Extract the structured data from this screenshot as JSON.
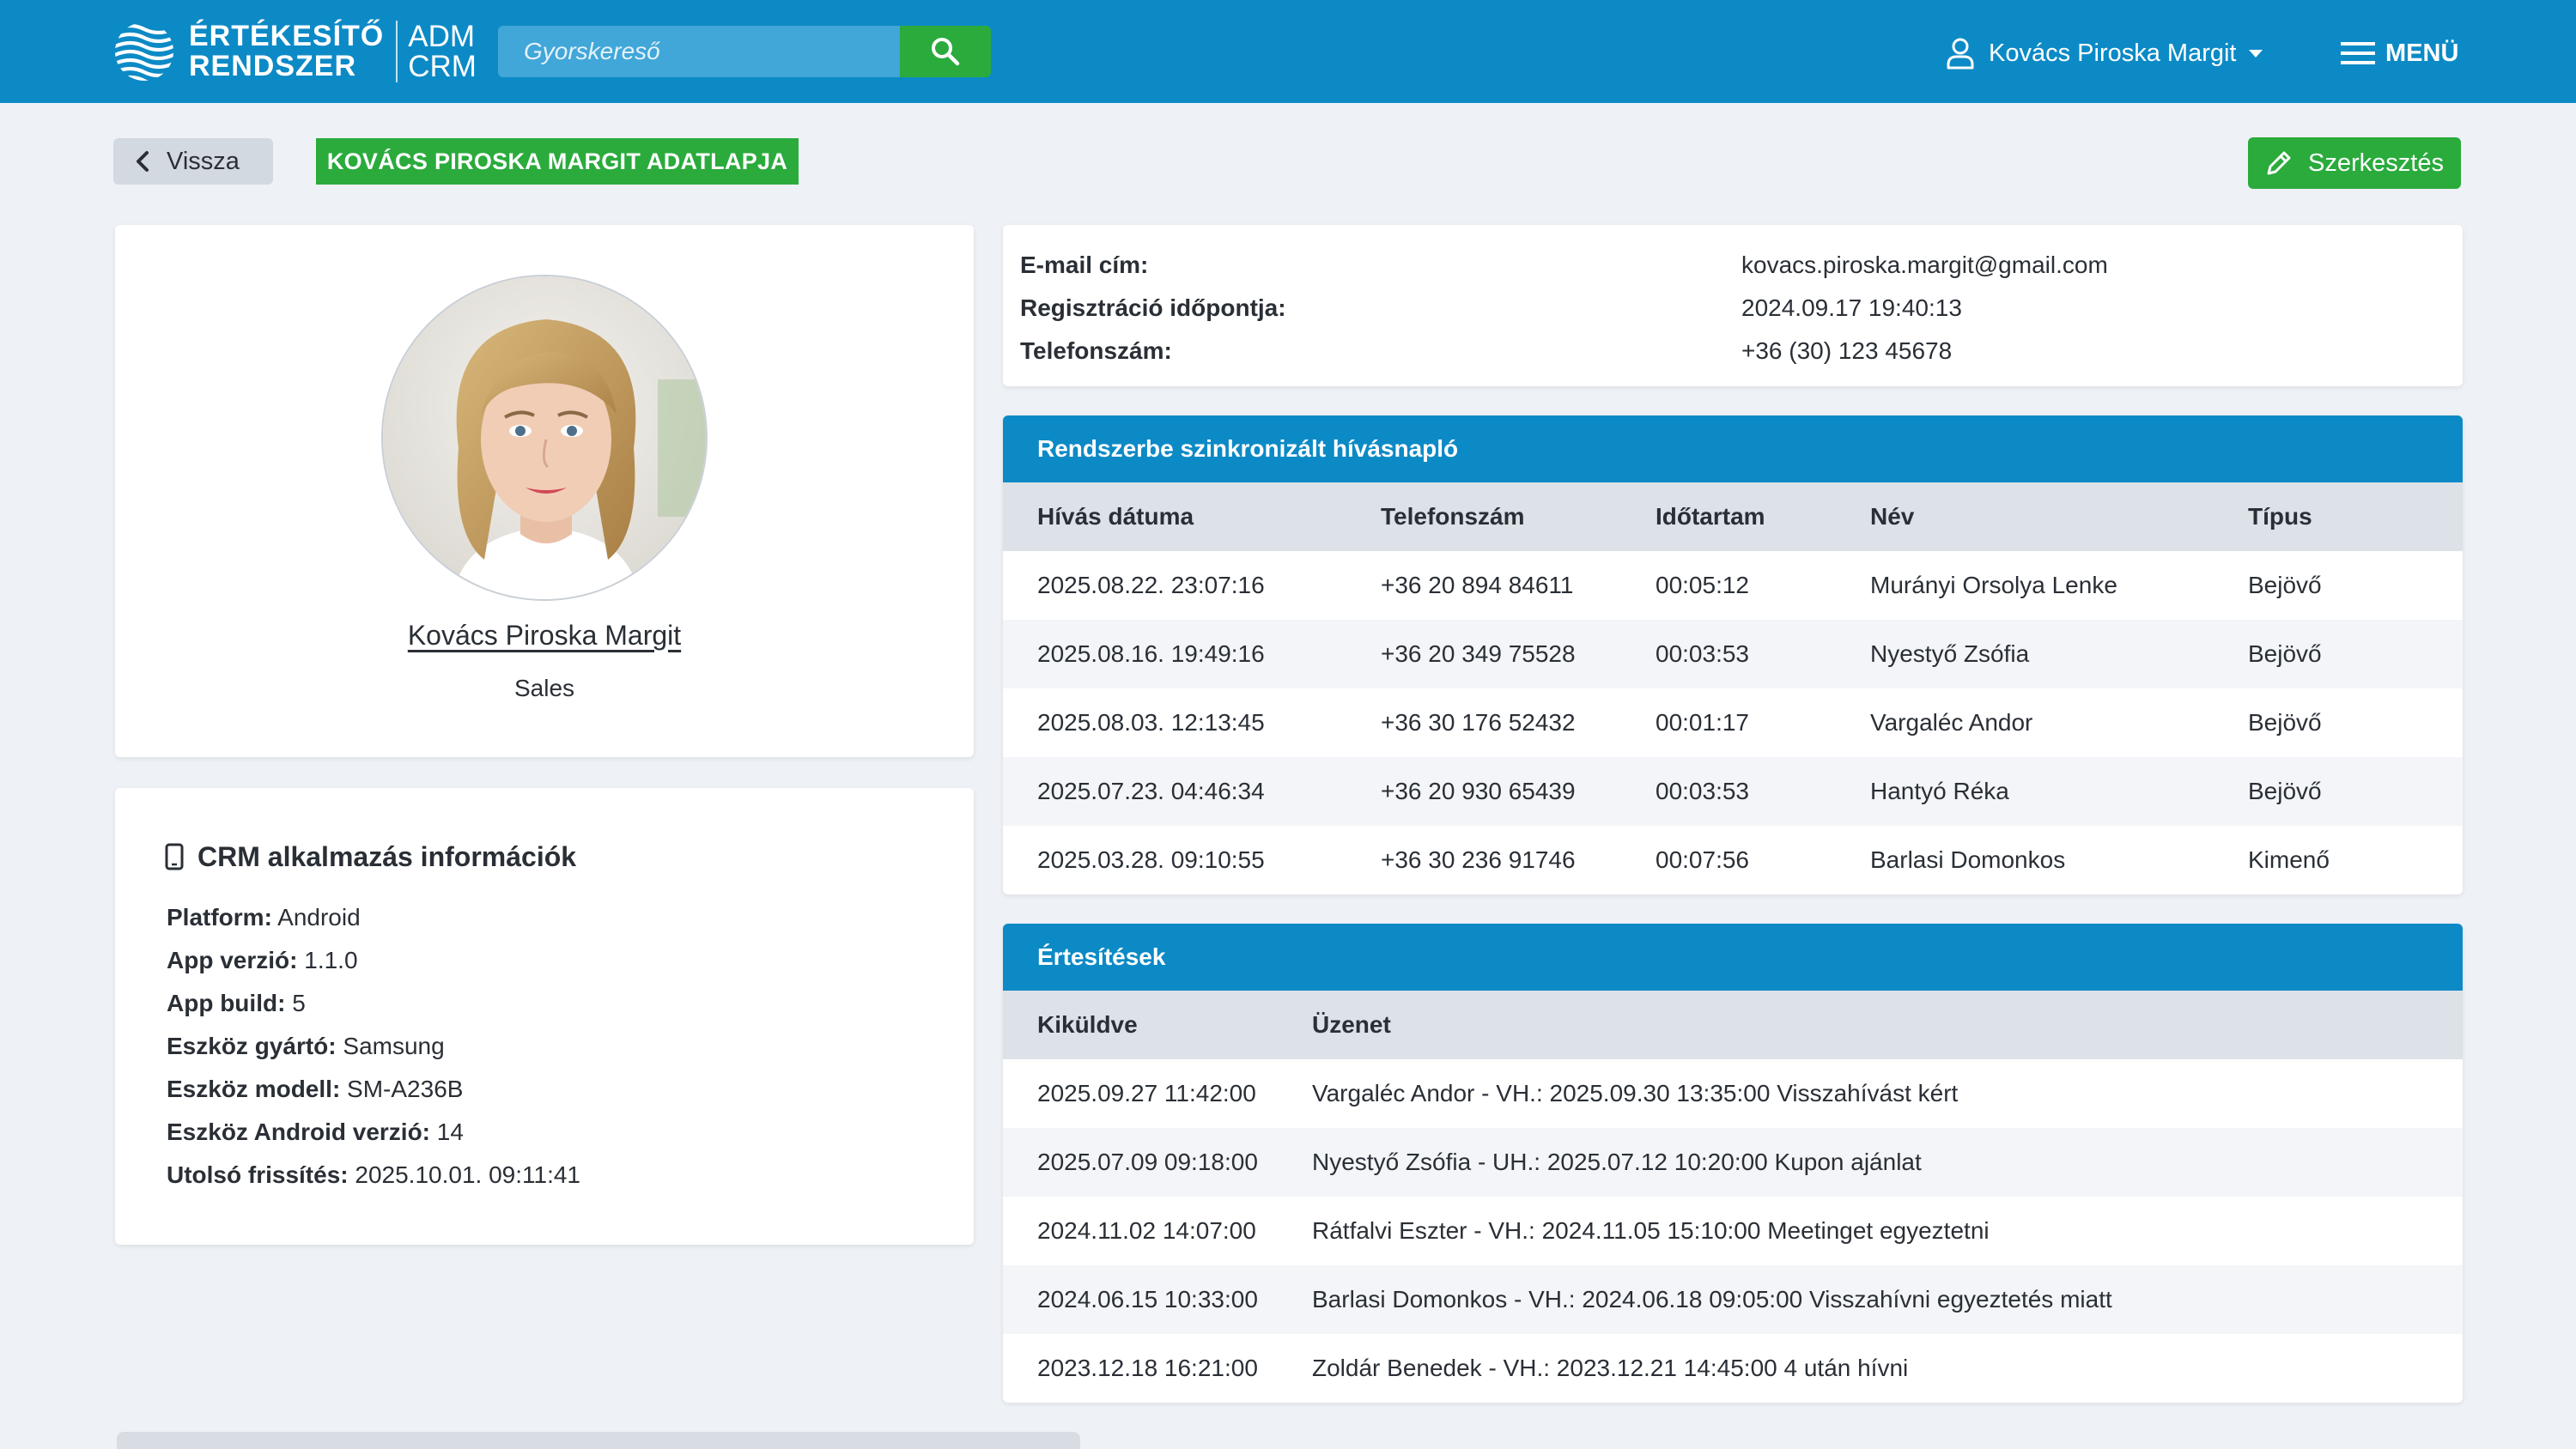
{
  "header": {
    "logo_line1": "ÉRTÉKESÍTŐ",
    "logo_line2": "RENDSZER",
    "logo_sub1": "ADM",
    "logo_sub2": "CRM",
    "search_placeholder": "Gyorskereső",
    "user_name": "Kovács Piroska Margit",
    "menu_label": "MENÜ"
  },
  "toolbar": {
    "back_label": "Vissza",
    "page_title": "KOVÁCS PIROSKA MARGIT ADATLAPJA",
    "edit_label": "Szerkesztés"
  },
  "profile": {
    "name": "Kovács Piroska Margit",
    "role": "Sales"
  },
  "crm": {
    "title": "CRM alkalmazás információk",
    "rows": [
      {
        "label": "Platform:",
        "value": "Android"
      },
      {
        "label": "App verzió:",
        "value": "1.1.0"
      },
      {
        "label": "App build:",
        "value": "5"
      },
      {
        "label": "Eszköz gyártó:",
        "value": "Samsung"
      },
      {
        "label": "Eszköz modell:",
        "value": "SM-A236B"
      },
      {
        "label": "Eszköz Android verzió:",
        "value": "14"
      },
      {
        "label": "Utolsó frissítés:",
        "value": "2025.10.01. 09:11:41"
      }
    ]
  },
  "info": [
    {
      "label": "E-mail cím:",
      "value": "kovacs.piroska.margit@gmail.com"
    },
    {
      "label": "Regisztráció időpontja:",
      "value": "2024.09.17 19:40:13"
    },
    {
      "label": "Telefonszám:",
      "value": "+36 (30) 123 45678"
    }
  ],
  "calls": {
    "title": "Rendszerbe szinkronizált hívásnapló",
    "columns": [
      "Hívás dátuma",
      "Telefonszám",
      "Időtartam",
      "Név",
      "Típus"
    ],
    "rows": [
      [
        "2025.08.22. 23:07:16",
        "+36 20 894 84611",
        "00:05:12",
        "Murányi Orsolya Lenke",
        "Bejövő"
      ],
      [
        "2025.08.16. 19:49:16",
        "+36 20 349 75528",
        "00:03:53",
        "Nyestyő Zsófia",
        "Bejövő"
      ],
      [
        "2025.08.03. 12:13:45",
        "+36 30 176 52432",
        "00:01:17",
        "Vargaléc Andor",
        "Bejövő"
      ],
      [
        "2025.07.23. 04:46:34",
        "+36 20 930 65439",
        "00:03:53",
        "Hantyó Réka",
        "Bejövő"
      ],
      [
        "2025.03.28. 09:10:55",
        "+36 30 236 91746",
        "00:07:56",
        "Barlasi Domonkos",
        "Kimenő"
      ]
    ]
  },
  "notifications": {
    "title": "Értesítések",
    "columns": [
      "Kiküldve",
      "Üzenet"
    ],
    "rows": [
      [
        "2025.09.27 11:42:00",
        "Vargaléc Andor - VH.: 2025.09.30 13:35:00 Visszahívást kért"
      ],
      [
        "2025.07.09 09:18:00",
        "Nyestyő Zsófia - UH.: 2025.07.12 10:20:00 Kupon ajánlat"
      ],
      [
        "2024.11.02 14:07:00",
        "Rátfalvi Eszter - VH.: 2024.11.05 15:10:00 Meetinget egyeztetni"
      ],
      [
        "2024.06.15 10:33:00",
        "Barlasi Domonkos - VH.: 2024.06.18 09:05:00 Visszahívni egyeztetés miatt"
      ],
      [
        "2023.12.18 16:21:00",
        "Zoldár Benedek - VH.: 2023.12.21 14:45:00 4 után hívni"
      ]
    ]
  },
  "colors": {
    "primary_blue": "#0c8ac6",
    "accent_green": "#2aab3c",
    "background": "#eef1f5"
  },
  "icons": {
    "logo": "wave-globe-icon",
    "search": "search-icon",
    "user": "user-icon",
    "menu": "hamburger-icon",
    "back": "chevron-left-icon",
    "edit": "pencil-icon",
    "device": "smartphone-icon"
  }
}
